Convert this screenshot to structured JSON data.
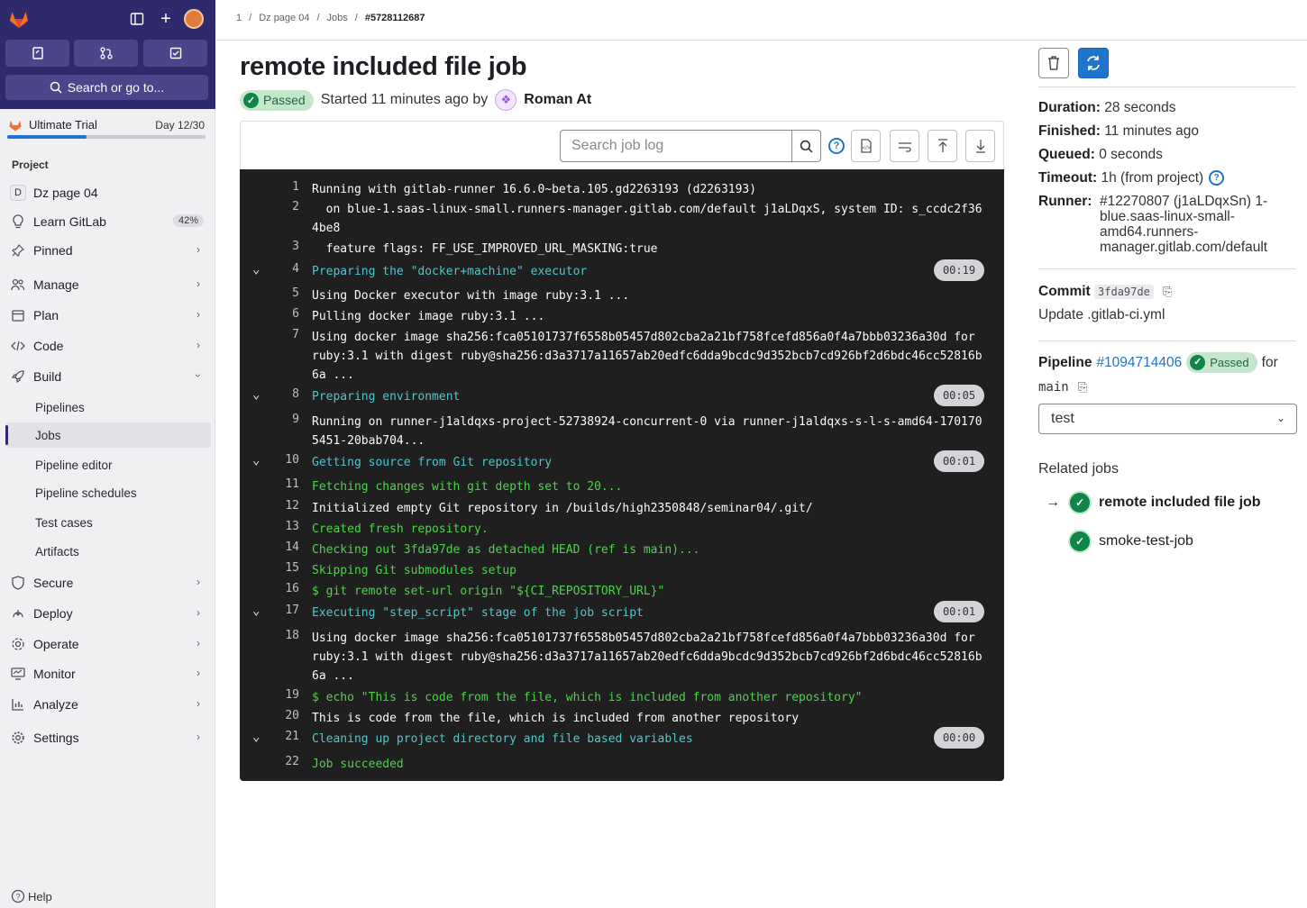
{
  "sidebar": {
    "search_label": "Search or go to...",
    "trial": {
      "label": "Ultimate Trial",
      "day": "Day 12/30",
      "progress": 0.4
    },
    "section_title": "Project",
    "project": {
      "badge": "D",
      "name": "Dz page 04"
    },
    "learn": {
      "label": "Learn GitLab",
      "pct": "42%"
    },
    "items": {
      "pinned": "Pinned",
      "manage": "Manage",
      "plan": "Plan",
      "code": "Code",
      "build": "Build",
      "secure": "Secure",
      "deploy": "Deploy",
      "operate": "Operate",
      "monitor": "Monitor",
      "analyze": "Analyze",
      "settings": "Settings"
    },
    "build_sub": {
      "pipelines": "Pipelines",
      "jobs": "Jobs",
      "pipeline_editor": "Pipeline editor",
      "pipeline_schedules": "Pipeline schedules",
      "test_cases": "Test cases",
      "artifacts": "Artifacts"
    },
    "help": "Help"
  },
  "breadcrumb": {
    "b1": "1",
    "b2": "Dz page 04",
    "b3": "Jobs",
    "b4": "#5728112687"
  },
  "job": {
    "title": "remote included file job",
    "status": "Passed",
    "started": "Started 11 minutes ago by",
    "user": "Roman At"
  },
  "log": {
    "search_placeholder": "Search job log",
    "lines": [
      {
        "n": "1",
        "t": "Running with gitlab-runner 16.6.0~beta.105.gd2263193 (d2263193)"
      },
      {
        "n": "2",
        "t": "  on blue-1.saas-linux-small.runners-manager.gitlab.com/default j1aLDqxS, system ID: s_ccdc2f364be8"
      },
      {
        "n": "3",
        "t": "  feature flags: FF_USE_IMPROVED_URL_MASKING:true"
      },
      {
        "n": "4",
        "t": "Preparing the \"docker+machine\" executor",
        "d": "00:19"
      },
      {
        "n": "5",
        "t": "Using Docker executor with image ruby:3.1 ..."
      },
      {
        "n": "6",
        "t": "Pulling docker image ruby:3.1 ..."
      },
      {
        "n": "7",
        "t": "Using docker image sha256:fca05101737f6558b05457d802cba2a21bf758fcefd856a0f4a7bbb03236a30d for ruby:3.1 with digest ruby@sha256:d3a3717a11657ab20edfc6dda9bcdc9d352bcb7cd926bf2d6bdc46cc52816b6a ..."
      },
      {
        "n": "8",
        "t": "Preparing environment",
        "d": "00:05"
      },
      {
        "n": "9",
        "t": "Running on runner-j1aldqxs-project-52738924-concurrent-0 via runner-j1aldqxs-s-l-s-amd64-1701705451-20bab704..."
      },
      {
        "n": "10",
        "t": "Getting source from Git repository",
        "d": "00:01"
      },
      {
        "n": "11",
        "t": "Fetching changes with git depth set to 20..."
      },
      {
        "n": "12",
        "t": "Initialized empty Git repository in /builds/high2350848/seminar04/.git/"
      },
      {
        "n": "13",
        "t": "Created fresh repository."
      },
      {
        "n": "14",
        "t": "Checking out 3fda97de as detached HEAD (ref is main)..."
      },
      {
        "n": "15",
        "t": "Skipping Git submodules setup"
      },
      {
        "n": "16",
        "t": "$ git remote set-url origin \"${CI_REPOSITORY_URL}\""
      },
      {
        "n": "17",
        "t": "Executing \"step_script\" stage of the job script",
        "d": "00:01"
      },
      {
        "n": "18",
        "t": "Using docker image sha256:fca05101737f6558b05457d802cba2a21bf758fcefd856a0f4a7bbb03236a30d for ruby:3.1 with digest ruby@sha256:d3a3717a11657ab20edfc6dda9bcdc9d352bcb7cd926bf2d6bdc46cc52816b6a ..."
      },
      {
        "n": "19",
        "t": "$ echo \"This is code from the file, which is included from another repository\""
      },
      {
        "n": "20",
        "t": "This is code from the file, which is included from another repository"
      },
      {
        "n": "21",
        "t": "Cleaning up project directory and file based variables",
        "d": "00:00"
      },
      {
        "n": "22",
        "t": "Job succeeded"
      }
    ]
  },
  "details": {
    "duration_k": "Duration:",
    "duration_v": "28 seconds",
    "finished_k": "Finished:",
    "finished_v": "11 minutes ago",
    "queued_k": "Queued:",
    "queued_v": "0 seconds",
    "timeout_k": "Timeout:",
    "timeout_v": "1h (from project)",
    "runner_k": "Runner:",
    "runner_v": "#12270807 (j1aLDqxSn) 1-blue.saas-linux-small-amd64.runners-manager.gitlab.com/default",
    "commit_k": "Commit",
    "commit_sha": "3fda97de",
    "commit_msg": "Update .gitlab-ci.yml",
    "pipeline_k": "Pipeline",
    "pipeline_id": "#1094714406",
    "pipeline_status": "Passed",
    "pipeline_for": "for",
    "pipeline_branch": "main",
    "stage_select": "test",
    "related_title": "Related jobs",
    "related": [
      "remote included file job",
      "smoke-test-job"
    ]
  }
}
